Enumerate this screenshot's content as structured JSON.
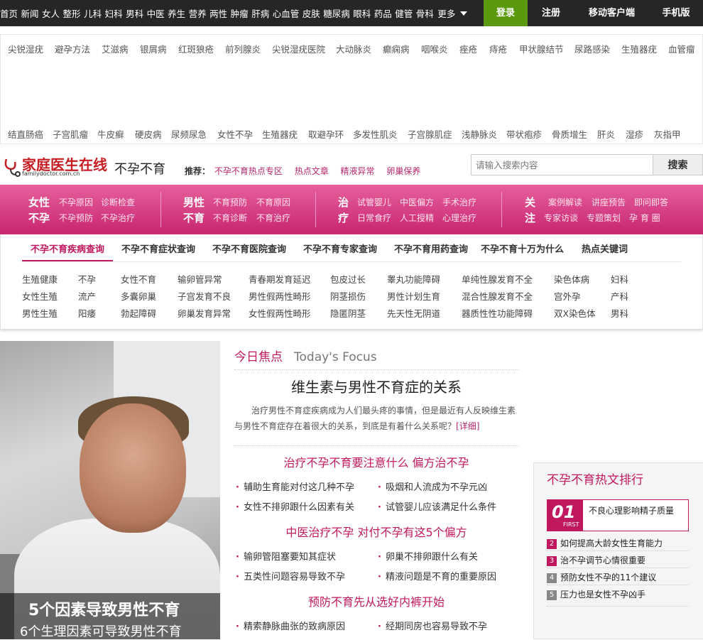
{
  "topbar": {
    "nav": [
      "首页",
      "新闻",
      "女人",
      "整形",
      "儿科",
      "妇科",
      "男科",
      "中医",
      "养生",
      "营养",
      "两性",
      "肿瘤",
      "肝病",
      "心血管",
      "皮肤",
      "糖尿病",
      "眼科",
      "药品",
      "健管",
      "骨科"
    ],
    "more": "更多",
    "login": "登录",
    "register": "注册",
    "mobile_client": "移动客户端",
    "mobile_version": "手机版",
    "colors": {
      "bar": "#262626",
      "login": "#5a9a0c"
    }
  },
  "tags": {
    "row1": [
      "尖锐湿疣",
      "避孕方法",
      "艾滋病",
      "银屑病",
      "红斑狼疮",
      "前列腺炎",
      "尖锐湿疣医院",
      "大动脉炎",
      "癫痫病",
      "咽喉炎",
      "痤疮",
      "痔疮",
      "甲状腺结节",
      "尿路感染",
      "生殖器疣",
      "血管瘤"
    ],
    "row2": [
      "结直肠癌",
      "子宫肌瘤",
      "牛皮癣",
      "硬皮病",
      "尿频尿急",
      "女性不孕",
      "生殖器疣",
      "取避孕环",
      "多发性肌炎",
      "子宫腺肌症",
      "浅静脉炎",
      "带状疱疹",
      "骨质增生",
      "肝炎",
      "湿疹",
      "灰指甲"
    ]
  },
  "header": {
    "logo_text": "家庭医生在线",
    "logo_sub": "familydoctor.com.cn",
    "channel": "不孕不育",
    "rec_label": "推荐：",
    "rec_links": [
      "不孕不育热点专区",
      "热点文章",
      "精液异常",
      "卵巢保养"
    ],
    "search_placeholder": "请输入搜索内容",
    "search_button": "搜索"
  },
  "pinknav": {
    "female": {
      "t1": "女性",
      "t2": "不孕",
      "links": [
        "不孕原因",
        "诊断检查",
        "不孕预防",
        "不孕治疗"
      ]
    },
    "male": {
      "t1": "男性",
      "t2": "不育",
      "links": [
        "不育预防",
        "不育原因",
        "不育诊断",
        "不育治疗"
      ]
    },
    "treat": {
      "t1": "治",
      "t2": "疗",
      "links": [
        "试管婴儿",
        "中医偏方",
        "手术治疗",
        "日常食疗",
        "人工授精",
        "心理治疗"
      ]
    },
    "care": {
      "t1": "关",
      "t2": "注",
      "links": [
        "案例解读",
        "讲座预告",
        "即问即答",
        "专家访谈",
        "专题策划",
        "孕 育 圈"
      ]
    },
    "color": "#d63f85"
  },
  "tabs": [
    "不孕不育疾病查询",
    "不孕不育症状查询",
    "不孕不育医院查询",
    "不孕不育专家查询",
    "不孕不育用药查询",
    "不孕不育十万为什么",
    "热点关键词"
  ],
  "keywords": {
    "row1": [
      "生殖健康",
      "不孕",
      "女性不育",
      "输卵管异常",
      "青春期发育延迟",
      "包皮过长",
      "睾丸功能障碍",
      "单纯性腺发育不全",
      "染色体病",
      "妇科"
    ],
    "row2": [
      "女性生殖",
      "流产",
      "多囊卵巢",
      "子宫发育不良",
      "男性假两性畸形",
      "阴茎损伤",
      "男性计划生育",
      "混合性腺发育不全",
      "宫外孕",
      "产科"
    ],
    "row3": [
      "男性生殖",
      "阳痿",
      "勃起障碍",
      "卵巢发育异常",
      "女性假两性畸形",
      "隐匿阴茎",
      "先天性无阴道",
      "器质性性功能障碍",
      "双X染色体",
      "男科"
    ]
  },
  "hero": {
    "title": "5个因素导致男性不育",
    "subtitle": "6个生理因素可导致男性不育"
  },
  "focus": {
    "label_cn": "今日焦点",
    "label_en": "Today's Focus",
    "title": "维生素与男性不育症的关系",
    "desc": "治疗男性不育症疾病成为人们最头疼的事情，但是最近有人反映维生素与男性不育症存在着很大的关系，到底是有着什么关系呢？",
    "more": "[详细]",
    "sections": [
      {
        "heading": "治疗不孕不育要注意什么 偏方治不孕",
        "items": [
          "辅助生育能对付这几种不孕",
          "吸烟和人流成为不孕元凶",
          "女性不排卵跟什么因素有关",
          "试管婴儿应该满足什么条件"
        ]
      },
      {
        "heading": "中医治疗不孕 对付不孕有这5个偏方",
        "items": [
          "输卵管阻塞要知其症状",
          "卵巢不排卵跟什么有关",
          "五类性问题容易导致不孕",
          "精液问题是不育的重要原因"
        ]
      },
      {
        "heading": "预防不育先从选好内裤开始",
        "items": [
          "精索静脉曲张的致病原因",
          "经期同房也容易导致不孕"
        ]
      }
    ]
  },
  "hot": {
    "title": "不孕不育热文排行",
    "first_num": "01",
    "first_label": "FIRST",
    "first_text": "不良心理影响精子质量",
    "items": [
      {
        "rank": "2",
        "text": "如何提高大龄女性生育能力",
        "color": "#c0185e"
      },
      {
        "rank": "3",
        "text": "治不孕调节心情很重要",
        "color": "#c0185e"
      },
      {
        "rank": "4",
        "text": "预防女性不孕的11个建议",
        "color": "#888888"
      },
      {
        "rank": "5",
        "text": "压力也是女性不孕凶手",
        "color": "#888888"
      }
    ]
  }
}
